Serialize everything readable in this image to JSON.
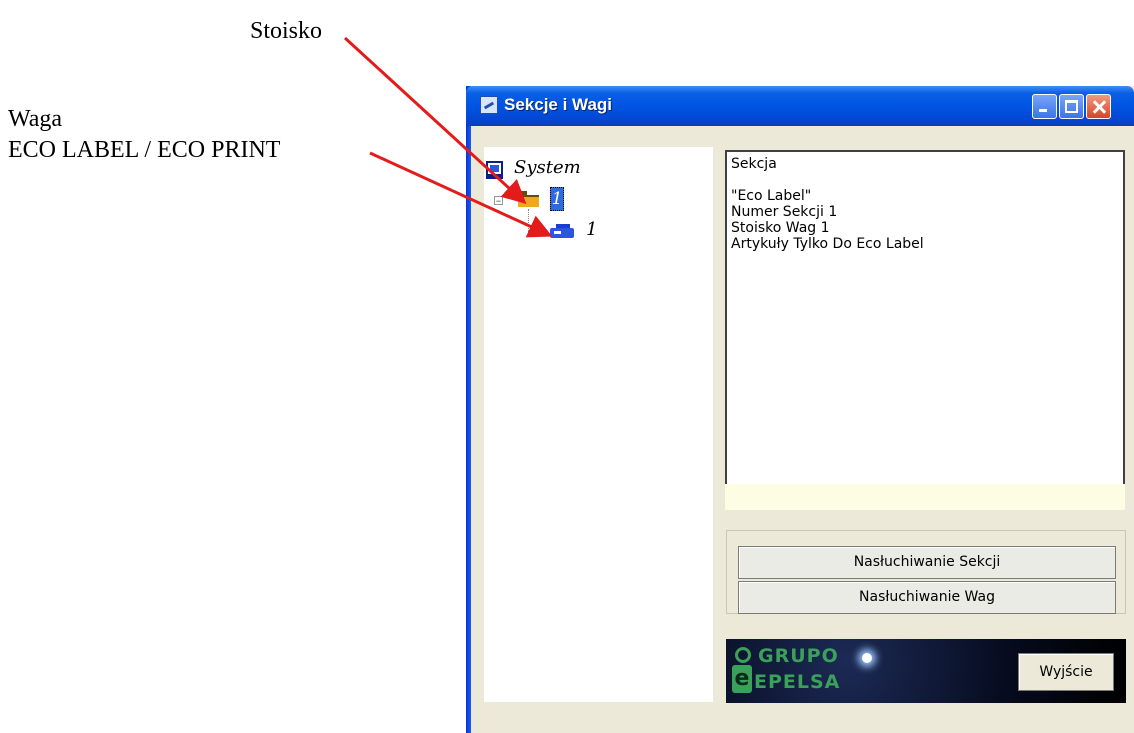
{
  "annotations": {
    "stoisko": "Stoisko",
    "waga_line1": "Waga",
    "waga_line2": "ECO LABEL / ECO PRINT",
    "arrow_color": "#e31b1b"
  },
  "window": {
    "title": "Sekcje i Wagi",
    "title_color": "#0054e3",
    "close_color": "#d9432a"
  },
  "tree": {
    "root_label": "System",
    "section_label": "1",
    "scale_label": "1"
  },
  "info_panel": {
    "lines": [
      "Sekcja",
      "",
      "\"Eco Label\"",
      "Numer Sekcji 1",
      "Stoisko Wag 1",
      "Artykuły Tylko Do Eco Label"
    ]
  },
  "buttons": {
    "listen_sections": "Nasłuchiwanie Sekcji",
    "listen_scales": "Nasłuchiwanie Wag",
    "exit": "Wyjście"
  },
  "banner": {
    "line1": "GRUPO",
    "line2": "EPELSA",
    "logo_letter": "e"
  }
}
